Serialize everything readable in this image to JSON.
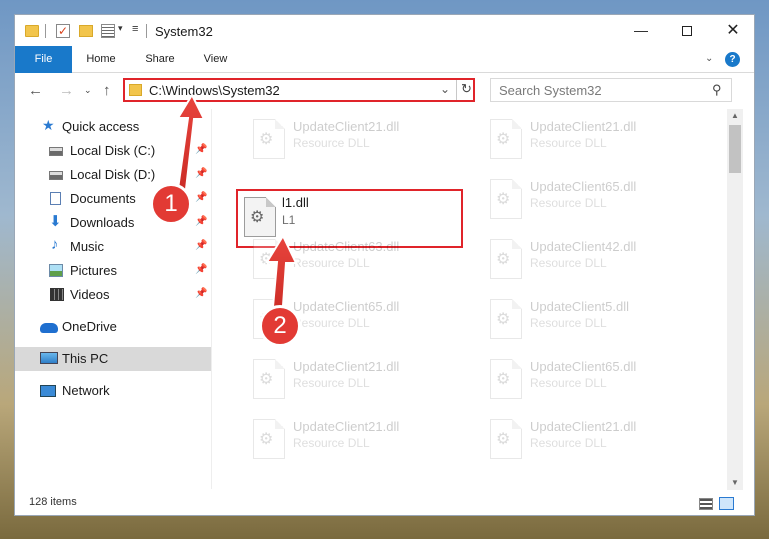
{
  "window": {
    "title": "System32"
  },
  "titlebar": {
    "check_glyph": "✓",
    "dropdown_glyph": "▾",
    "customize_glyph": "≡",
    "minimize_glyph": "—",
    "close_glyph": "✕"
  },
  "ribbon": {
    "tabs": [
      "File",
      "Home",
      "Share",
      "View"
    ],
    "collapse_glyph": "⌄",
    "help_glyph": "?"
  },
  "navigation": {
    "back_glyph": "←",
    "forward_glyph": "→",
    "recent_glyph": "⌄",
    "up_glyph": "↑"
  },
  "address_bar": {
    "path": "C:\\Windows\\System32",
    "chevron_glyph": "⌄",
    "refresh_glyph": "↻"
  },
  "search": {
    "placeholder": "Search System32",
    "icon_glyph": "⚲"
  },
  "nav_pane": {
    "items": [
      {
        "label": "Quick access",
        "icon": "star-icon",
        "glyph": "★"
      },
      {
        "label": "Local Disk (C:)",
        "icon": "disk-icon",
        "pinned": true
      },
      {
        "label": "Local Disk (D:)",
        "icon": "disk-icon",
        "pinned": true
      },
      {
        "label": "Documents",
        "icon": "document-icon",
        "pinned": true
      },
      {
        "label": "Downloads",
        "icon": "download-icon",
        "glyph": "⬇",
        "pinned": true
      },
      {
        "label": "Music",
        "icon": "music-icon",
        "glyph": "♪",
        "pinned": true
      },
      {
        "label": "Pictures",
        "icon": "picture-icon",
        "pinned": true
      },
      {
        "label": "Videos",
        "icon": "video-icon",
        "pinned": true
      },
      {
        "label": "OneDrive",
        "icon": "cloud-icon"
      },
      {
        "label": "This PC",
        "icon": "computer-icon",
        "selected": true
      },
      {
        "label": "Network",
        "icon": "network-icon"
      }
    ],
    "pin_glyph": "📌"
  },
  "files": {
    "gear_glyph": "⚙",
    "items": [
      {
        "name": "UpdateClient21.dll",
        "type": "Resource DLL"
      },
      {
        "name": "UpdateClient21.dll",
        "type": "Resource DLL"
      },
      {
        "name": "l1.dll",
        "type": "L1"
      },
      {
        "name": "UpdateClient65.dll",
        "type": "Resource DLL"
      },
      {
        "name": "UpdateClient63.dll",
        "type": "Resource DLL"
      },
      {
        "name": "UpdateClient42.dll",
        "type": "Resource DLL"
      },
      {
        "name": "UpdateClient65.dll",
        "type": "Resource DLL"
      },
      {
        "name": "UpdateClient5.dll",
        "type": "Resource DLL"
      },
      {
        "name": "UpdateClient21.dll",
        "type": "Resource DLL"
      },
      {
        "name": "UpdateClient65.dll",
        "type": "Resource DLL"
      },
      {
        "name": "UpdateClient21.dll",
        "type": "Resource DLL"
      },
      {
        "name": "UpdateClient21.dll",
        "type": "Resource DLL"
      }
    ]
  },
  "scrollbar": {
    "up_glyph": "▲",
    "down_glyph": "▼"
  },
  "status": {
    "item_count": "128 items"
  },
  "annotations": {
    "step1": "1",
    "step2": "2"
  },
  "colors": {
    "accent": "#1979ca",
    "highlight_red": "#e0242a",
    "callout_red": "#e23a34"
  }
}
